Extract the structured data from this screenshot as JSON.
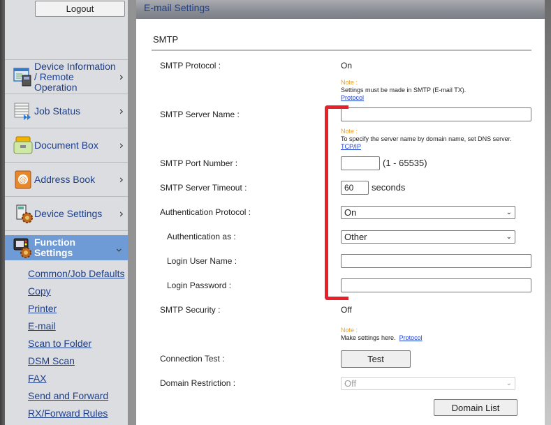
{
  "sidebar": {
    "logout_label": "Logout",
    "nav_items": [
      {
        "label": "Device Information / Remote Operation",
        "icon": "device-information-icon",
        "chevron": "›"
      },
      {
        "label": "Job Status",
        "icon": "job-status-icon",
        "chevron": "›"
      },
      {
        "label": "Document Box",
        "icon": "document-box-icon",
        "chevron": "›"
      },
      {
        "label": "Address Book",
        "icon": "address-book-icon",
        "chevron": "›"
      },
      {
        "label": "Device Settings",
        "icon": "device-settings-icon",
        "chevron": "›"
      },
      {
        "label": "Function Settings",
        "icon": "function-settings-icon",
        "chevron": "⌄",
        "active": true
      }
    ],
    "sub_items": [
      "Common/Job Defaults",
      "Copy",
      "Printer",
      "E-mail",
      "Scan to Folder",
      "DSM Scan",
      "FAX",
      "Send and Forward",
      "RX/Forward Rules"
    ]
  },
  "main": {
    "header_title": "E-mail Settings",
    "section_title": "SMTP",
    "fields": {
      "smtp_protocol": {
        "label": "SMTP Protocol :",
        "value": "On",
        "note_label": "Note :",
        "note_text": "Settings must be made in SMTP (E-mail TX).",
        "note_link": "Protocol"
      },
      "smtp_server_name": {
        "label": "SMTP Server Name :",
        "value": "",
        "note_label": "Note :",
        "note_text": "To specify the server name by domain name, set DNS server.",
        "note_link": "TCP/IP"
      },
      "smtp_port_number": {
        "label": "SMTP Port Number :",
        "value": "",
        "range": "(1 - 65535)"
      },
      "smtp_server_timeout": {
        "label": "SMTP Server Timeout :",
        "value": "60",
        "unit": "seconds"
      },
      "authentication_protocol": {
        "label": "Authentication Protocol :",
        "selected": "On"
      },
      "authentication_as": {
        "label": "Authentication as :",
        "selected": "Other"
      },
      "login_user_name": {
        "label": "Login User Name :",
        "value": ""
      },
      "login_password": {
        "label": "Login Password :",
        "value": ""
      },
      "smtp_security": {
        "label": "SMTP Security :",
        "value": "Off",
        "note_label": "Note :",
        "note_text": "Make settings here.",
        "note_link": "Protocol"
      },
      "connection_test": {
        "label": "Connection Test :",
        "button": "Test"
      },
      "domain_restriction": {
        "label": "Domain Restriction :",
        "selected": "Off",
        "disabled": true,
        "button": "Domain List"
      }
    }
  },
  "annotation": {
    "color": "#e8202a"
  },
  "colors": {
    "accent": "#6e9ad6",
    "link": "#1d3f8c",
    "note": "#f0a020"
  }
}
